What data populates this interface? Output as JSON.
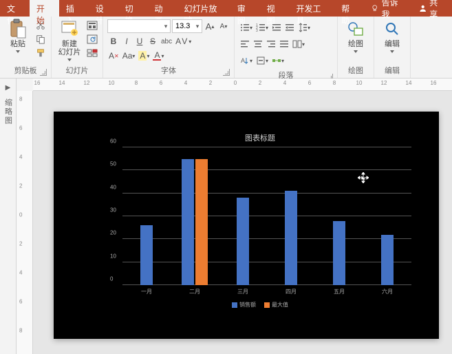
{
  "tabs": {
    "file": "文件",
    "home": "开始",
    "insert": "插入",
    "design": "设计",
    "transition": "切换",
    "animation": "动画",
    "slideshow": "幻灯片放映",
    "review": "审阅",
    "view": "视图",
    "developer": "开发工具",
    "help": "帮助",
    "tellme": "告诉我",
    "share": "共享"
  },
  "ribbon": {
    "clipboard": {
      "label": "剪贴板",
      "paste": "粘贴"
    },
    "slides": {
      "label": "幻灯片",
      "new_slide": "新建\n幻灯片"
    },
    "font": {
      "label": "字体",
      "size_value": "13.3"
    },
    "paragraph": {
      "label": "段落"
    },
    "drawing": {
      "label": "绘图",
      "draw": "绘图"
    },
    "editing": {
      "label": "编辑",
      "edit": "编辑"
    }
  },
  "ruler": {
    "h": [
      "16",
      "14",
      "12",
      "10",
      "8",
      "6",
      "4",
      "2",
      "0",
      "2",
      "4",
      "6",
      "8",
      "10",
      "12",
      "14",
      "16"
    ],
    "v": [
      "8",
      "6",
      "4",
      "2",
      "0",
      "2",
      "4",
      "6",
      "8"
    ]
  },
  "sidepanel": {
    "label": "缩略图"
  },
  "chart_data": {
    "type": "bar",
    "title": "图表标题",
    "ylim": [
      0,
      60
    ],
    "yticks": [
      0,
      10,
      20,
      30,
      40,
      50,
      60
    ],
    "categories": [
      "一月",
      "二月",
      "三月",
      "四月",
      "五月",
      "六月"
    ],
    "series": [
      {
        "name": "销售额",
        "color": "#4472c4",
        "values": [
          26,
          55,
          38,
          41,
          28,
          22
        ]
      },
      {
        "name": "最大值",
        "color": "#ed7d31",
        "values": [
          null,
          55,
          null,
          null,
          null,
          null
        ]
      }
    ]
  }
}
